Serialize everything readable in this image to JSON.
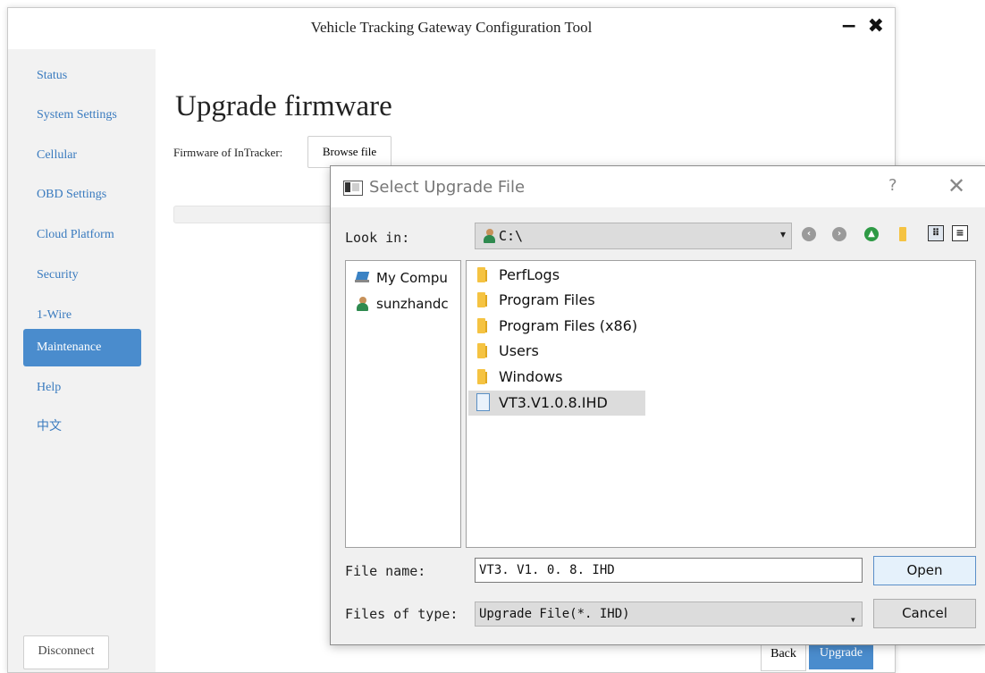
{
  "window": {
    "title": "Vehicle Tracking Gateway Configuration Tool",
    "minimize_glyph": "−",
    "close_glyph": "✖"
  },
  "sidebar": {
    "items": [
      {
        "label": "Status"
      },
      {
        "label": "System Settings"
      },
      {
        "label": "Cellular"
      },
      {
        "label": "OBD Settings"
      },
      {
        "label": "Cloud Platform"
      },
      {
        "label": "Security"
      },
      {
        "label": "1-Wire"
      },
      {
        "label": "Maintenance",
        "active": true
      },
      {
        "label": "Help"
      },
      {
        "label": "中文"
      }
    ],
    "disconnect_label": "Disconnect"
  },
  "main": {
    "heading": "Upgrade firmware",
    "firmware_label": "Firmware of InTracker:",
    "browse_label": "Browse file",
    "back_label": "Back",
    "upgrade_label": "Upgrade"
  },
  "dialog": {
    "title": "Select Upgrade File",
    "help_glyph": "?",
    "close_glyph": "✕",
    "look_in_label": "Look in:",
    "look_in_value": "C:\\",
    "nav_icons": [
      "back-icon",
      "forward-icon",
      "up-icon",
      "new-folder-icon",
      "detail-view-icon",
      "list-view-icon"
    ],
    "sidebar_places": [
      {
        "label": "My Compu",
        "icon": "computer-icon"
      },
      {
        "label": "sunzhandc",
        "icon": "user-icon"
      }
    ],
    "files": [
      {
        "name": "PerfLogs",
        "type": "folder"
      },
      {
        "name": "Program Files",
        "type": "folder"
      },
      {
        "name": "Program Files (x86)",
        "type": "folder"
      },
      {
        "name": "Users",
        "type": "folder"
      },
      {
        "name": "Windows",
        "type": "folder"
      },
      {
        "name": "VT3.V1.0.8.IHD",
        "type": "file",
        "selected": true
      }
    ],
    "file_name_label": "File name:",
    "file_name_value": "VT3. V1. 0. 8. IHD",
    "files_of_type_label": "Files of type:",
    "files_of_type_value": "Upgrade File(*. IHD)",
    "open_label": "Open",
    "cancel_label": "Cancel"
  },
  "colors": {
    "accent": "#4a8ccd",
    "nav_text": "#3a7bbf",
    "sidebar_bg": "#f2f2f2",
    "dialog_bg": "#f0f0f0",
    "folder": "#f5c342"
  }
}
